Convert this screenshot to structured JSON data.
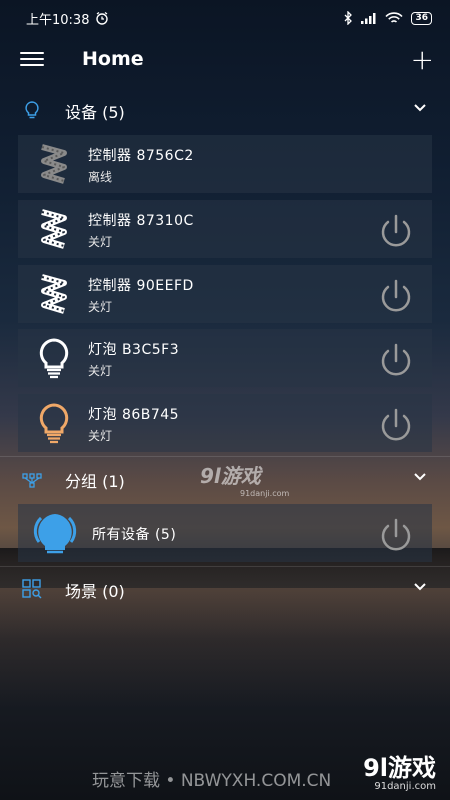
{
  "status_bar": {
    "time": "上午10:38",
    "battery": "36"
  },
  "app_bar": {
    "title": "Home"
  },
  "sections": {
    "devices": {
      "title": "设备 (5)"
    },
    "groups": {
      "title": "分组 (1)"
    },
    "scenes": {
      "title": "场景 (0)"
    }
  },
  "devices": [
    {
      "name": "控制器 8756C2",
      "status": "离线",
      "icon": "led-strip-icon"
    },
    {
      "name": "控制器 87310C",
      "status": "关灯",
      "icon": "led-strip-icon"
    },
    {
      "name": "控制器 90EEFD",
      "status": "关灯",
      "icon": "led-strip-icon"
    },
    {
      "name": "灯泡 B3C5F3",
      "status": "关灯",
      "icon": "bulb-white-icon"
    },
    {
      "name": "灯泡 86B745",
      "status": "关灯",
      "icon": "bulb-orange-icon"
    }
  ],
  "group": {
    "name": "所有设备 (5)",
    "icon": "bulb-blue-icon"
  },
  "watermark": {
    "logo": "9l游戏",
    "url": "91danji.com"
  },
  "footer": {
    "text": "玩意下载 • NBWYXH.COM.CN",
    "logo": "9l游戏",
    "url": "91danji.com"
  },
  "colors": {
    "accent_blue": "#3da0e8",
    "bulb_orange": "#f0a868",
    "power_gray": "#9a9a9a"
  }
}
